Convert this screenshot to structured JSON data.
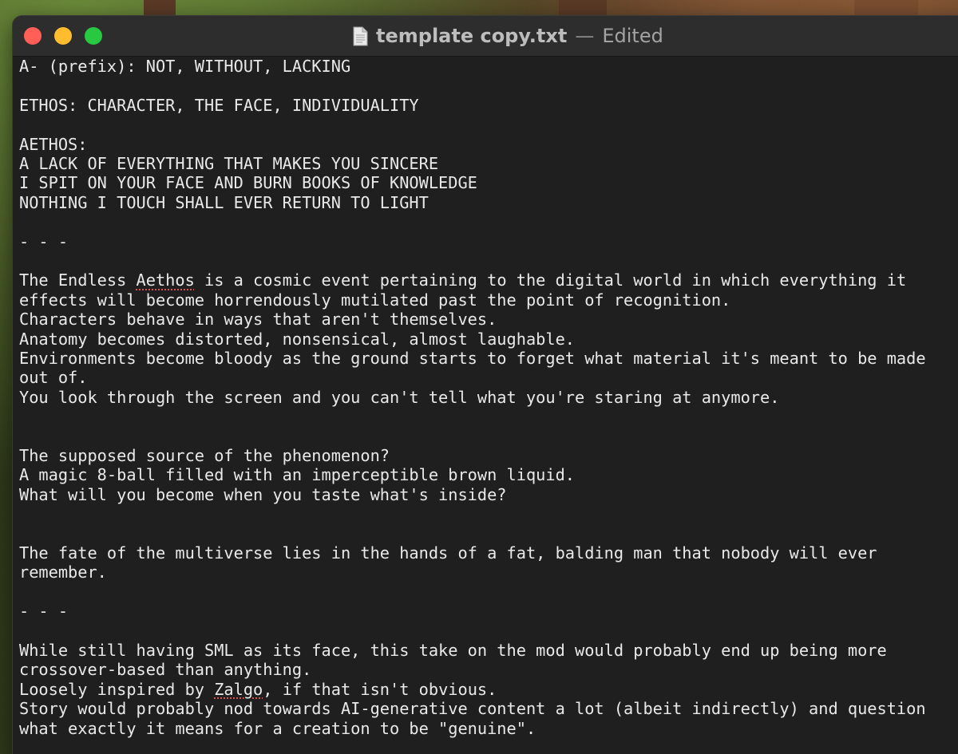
{
  "window": {
    "filename": "template copy.txt",
    "separator": "—",
    "status": "Edited"
  },
  "icons": {
    "document": "document-icon",
    "close": "close-button",
    "minimize": "minimize-button",
    "zoom": "zoom-button"
  },
  "colors": {
    "close": "#ff5f57",
    "minimize": "#febc2e",
    "zoom": "#28c840",
    "editor_bg": "#1f1f1f",
    "text": "#e9e9e9",
    "spellcheck": "#d9534f"
  },
  "document": {
    "lines": [
      [
        {
          "t": "A- (prefix): NOT, WITHOUT, LACKING"
        }
      ],
      [],
      [
        {
          "t": "ETHOS: CHARACTER, THE FACE, INDIVIDUALITY"
        }
      ],
      [],
      [
        {
          "t": "AETHOS:"
        }
      ],
      [
        {
          "t": "A LACK OF EVERYTHING THAT MAKES YOU SINCERE"
        }
      ],
      [
        {
          "t": "I SPIT ON YOUR FACE AND BURN BOOKS OF KNOWLEDGE"
        }
      ],
      [
        {
          "t": "NOTHING I TOUCH SHALL EVER RETURN TO LIGHT"
        }
      ],
      [],
      [
        {
          "t": "- - -"
        }
      ],
      [],
      [
        {
          "t": "The Endless "
        },
        {
          "t": "Aethos",
          "spell": true
        },
        {
          "t": " is a cosmic event pertaining to the digital world in which everything it"
        }
      ],
      [
        {
          "t": "effects will become horrendously mutilated past the point of recognition."
        }
      ],
      [
        {
          "t": "Characters behave in ways that aren't themselves."
        }
      ],
      [
        {
          "t": "Anatomy becomes distorted, nonsensical, almost laughable."
        }
      ],
      [
        {
          "t": "Environments become bloody as the ground starts to forget what material it's meant to be made"
        }
      ],
      [
        {
          "t": "out of."
        }
      ],
      [
        {
          "t": "You look through the screen and you can't tell what you're staring at anymore."
        }
      ],
      [],
      [],
      [
        {
          "t": "The supposed source of the phenomenon?"
        }
      ],
      [
        {
          "t": "A magic 8-ball filled with an imperceptible brown liquid."
        }
      ],
      [
        {
          "t": "What will you become when you taste what's inside?"
        }
      ],
      [],
      [],
      [
        {
          "t": "The fate of the multiverse lies in the hands of a fat, balding man that nobody will ever"
        }
      ],
      [
        {
          "t": "remember."
        }
      ],
      [],
      [
        {
          "t": "- - -"
        }
      ],
      [],
      [
        {
          "t": "While still having SML as its face, this take on the mod would probably end up being more"
        }
      ],
      [
        {
          "t": "crossover-based than anything."
        }
      ],
      [
        {
          "t": "Loosely inspired by "
        },
        {
          "t": "Zalgo",
          "spell": true
        },
        {
          "t": ", if that isn't obvious."
        }
      ],
      [
        {
          "t": "Story would probably nod towards AI-generative content a lot (albeit indirectly) and question"
        }
      ],
      [
        {
          "t": "what exactly it means for a creation to be \"genuine\"."
        }
      ]
    ]
  }
}
